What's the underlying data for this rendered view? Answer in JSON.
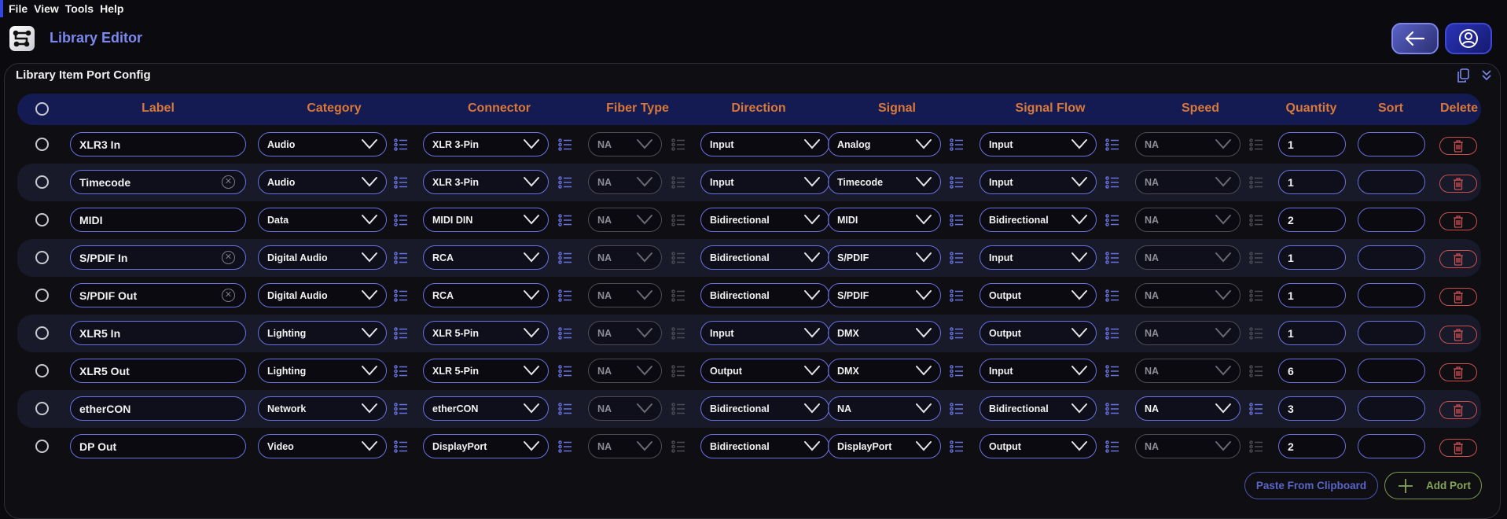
{
  "menu": [
    "File",
    "View",
    "Tools",
    "Help"
  ],
  "app": {
    "title": "Library Editor"
  },
  "panel": {
    "title": "Library Item Port Config"
  },
  "columns": [
    "Label",
    "Category",
    "Connector",
    "Fiber Type",
    "Direction",
    "Signal",
    "Signal Flow",
    "Speed",
    "Quantity",
    "Sort",
    "Delete"
  ],
  "rows": [
    {
      "label": "XLR3 In",
      "clearable": false,
      "category": "Audio",
      "connector": "XLR 3-Pin",
      "fiber": "NA",
      "fiber_enabled": false,
      "direction": "Input",
      "signal": "Analog",
      "flow": "Input",
      "speed": "NA",
      "speed_enabled": false,
      "quantity": "1",
      "sort": ""
    },
    {
      "label": "Timecode",
      "clearable": true,
      "category": "Audio",
      "connector": "XLR 3-Pin",
      "fiber": "NA",
      "fiber_enabled": false,
      "direction": "Input",
      "signal": "Timecode",
      "flow": "Input",
      "speed": "NA",
      "speed_enabled": false,
      "quantity": "1",
      "sort": ""
    },
    {
      "label": "MIDI",
      "clearable": false,
      "category": "Data",
      "connector": "MIDI DIN",
      "fiber": "NA",
      "fiber_enabled": false,
      "direction": "Bidirectional",
      "signal": "MIDI",
      "flow": "Bidirectional",
      "speed": "NA",
      "speed_enabled": false,
      "quantity": "2",
      "sort": ""
    },
    {
      "label": "S/PDIF In",
      "clearable": true,
      "category": "Digital Audio",
      "connector": "RCA",
      "fiber": "NA",
      "fiber_enabled": false,
      "direction": "Bidirectional",
      "signal": "S/PDIF",
      "flow": "Input",
      "speed": "NA",
      "speed_enabled": false,
      "quantity": "1",
      "sort": ""
    },
    {
      "label": "S/PDIF Out",
      "clearable": true,
      "category": "Digital Audio",
      "connector": "RCA",
      "fiber": "NA",
      "fiber_enabled": false,
      "direction": "Bidirectional",
      "signal": "S/PDIF",
      "flow": "Output",
      "speed": "NA",
      "speed_enabled": false,
      "quantity": "1",
      "sort": ""
    },
    {
      "label": "XLR5 In",
      "clearable": false,
      "category": "Lighting",
      "connector": "XLR 5-Pin",
      "fiber": "NA",
      "fiber_enabled": false,
      "direction": "Input",
      "signal": "DMX",
      "flow": "Output",
      "speed": "NA",
      "speed_enabled": false,
      "quantity": "1",
      "sort": ""
    },
    {
      "label": "XLR5 Out",
      "clearable": false,
      "category": "Lighting",
      "connector": "XLR 5-Pin",
      "fiber": "NA",
      "fiber_enabled": false,
      "direction": "Output",
      "signal": "DMX",
      "flow": "Input",
      "speed": "NA",
      "speed_enabled": false,
      "quantity": "6",
      "sort": ""
    },
    {
      "label": "etherCON",
      "clearable": false,
      "category": "Network",
      "connector": "etherCON",
      "fiber": "NA",
      "fiber_enabled": false,
      "direction": "Bidirectional",
      "signal": "NA",
      "flow": "Bidirectional",
      "speed": "NA",
      "speed_enabled": true,
      "quantity": "3",
      "sort": ""
    },
    {
      "label": "DP Out",
      "clearable": false,
      "category": "Video",
      "connector": "DisplayPort",
      "fiber": "NA",
      "fiber_enabled": false,
      "direction": "Bidirectional",
      "signal": "DisplayPort",
      "flow": "Output",
      "speed": "NA",
      "speed_enabled": false,
      "quantity": "2",
      "sort": ""
    }
  ],
  "actions": {
    "paste": "Paste From Clipboard",
    "add": "Add Port"
  },
  "colors": {
    "accent": "#6872e0",
    "header_text": "#d8793a",
    "danger": "#c95050",
    "success": "#86a657",
    "title": "#7a88f0"
  }
}
